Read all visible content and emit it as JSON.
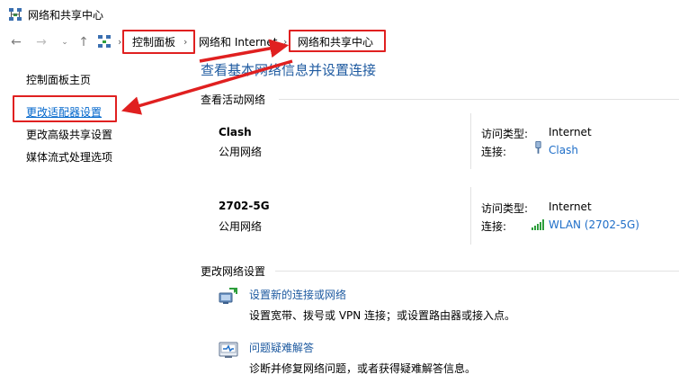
{
  "window": {
    "title": "网络和共享中心"
  },
  "address_bar": {
    "crumbs": [
      "控制面板",
      "网络和 Internet",
      "网络和共享中心"
    ]
  },
  "sidebar": {
    "items": [
      {
        "label": "控制面板主页"
      },
      {
        "label": "更改适配器设置"
      },
      {
        "label": "更改高级共享设置"
      },
      {
        "label": "媒体流式处理选项"
      }
    ]
  },
  "main": {
    "heading": "查看基本网络信息并设置连接",
    "active_section_title": "查看活动网络",
    "networks": [
      {
        "name": "Clash",
        "category": "公用网络",
        "access_label": "访问类型:",
        "access_value": "Internet",
        "connection_label": "连接:",
        "connection_value": "Clash",
        "connection_icon": "ethernet-plug-icon"
      },
      {
        "name": "2702-5G",
        "category": "公用网络",
        "access_label": "访问类型:",
        "access_value": "Internet",
        "connection_label": "连接:",
        "connection_value": "WLAN (2702-5G)",
        "connection_icon": "wifi-signal-icon"
      }
    ],
    "change_section_title": "更改网络设置",
    "settings": [
      {
        "title": "设置新的连接或网络",
        "description": "设置宽带、拨号或 VPN 连接；或设置路由器或接入点。",
        "icon": "new-connection-icon"
      },
      {
        "title": "问题疑难解答",
        "description": "诊断并修复网络问题，或者获得疑难解答信息。",
        "icon": "troubleshoot-icon"
      }
    ]
  },
  "annotation": {
    "color": "#e02020"
  }
}
